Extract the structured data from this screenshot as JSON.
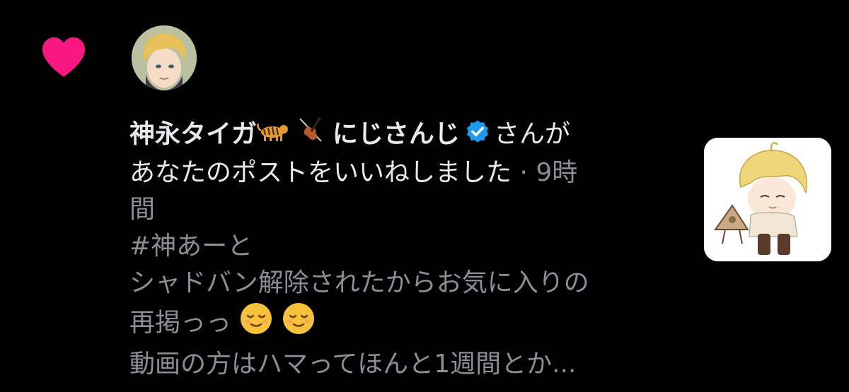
{
  "notification": {
    "type_icon": "heart-icon",
    "accent_color": "#f91880",
    "verified_color": "#1d9bf0",
    "user_name": "神永タイガ",
    "user_name_suffix": "にじさんじ",
    "name_emojis": [
      "tiger-emoji",
      "violin-emoji"
    ],
    "action_suffix": "さんが",
    "action_text": "あなたのポストをいいねしました",
    "time_separator": "·",
    "time_ago": "9時",
    "time_ago_cont": "間"
  },
  "liked_post": {
    "line1": "#神あーと",
    "line2": "シャドバン解除されたからお気に入りの",
    "line3": "再掲っっ",
    "line3_emojis": [
      "relieved-face-emoji",
      "relieved-face-emoji"
    ],
    "line4": "動画の方はハマってほんと1週間とか..."
  }
}
